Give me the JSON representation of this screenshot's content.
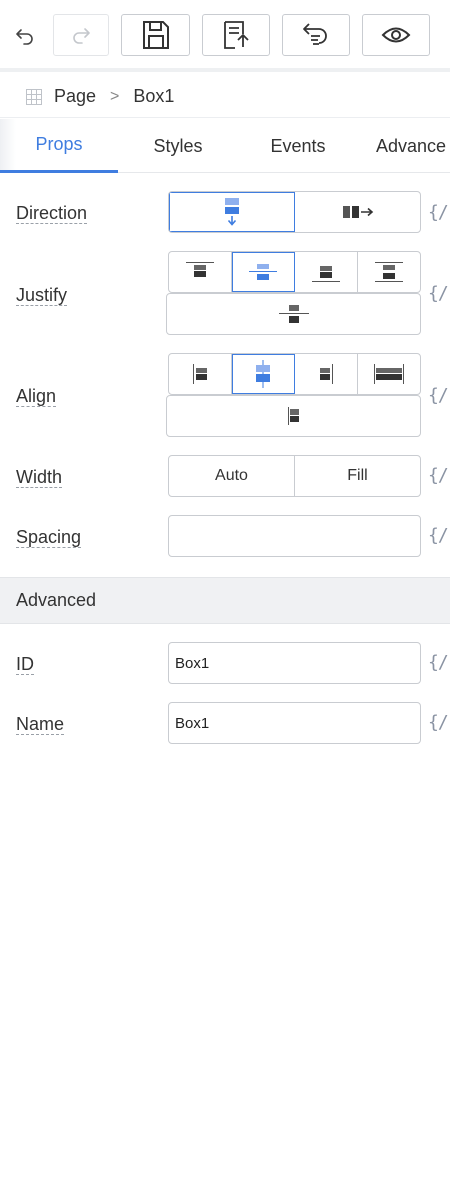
{
  "toolbar": {
    "undo_icon": "undo-icon",
    "redo_icon": "redo-icon",
    "save_icon": "save-icon",
    "export_icon": "export-icon",
    "revert_icon": "revert-icon",
    "preview_icon": "eye-icon"
  },
  "breadcrumb": {
    "root": "Page",
    "separator": ">",
    "current": "Box1"
  },
  "tabs": [
    {
      "label": "Props",
      "active": true
    },
    {
      "label": "Styles",
      "active": false
    },
    {
      "label": "Events",
      "active": false
    },
    {
      "label": "Advance",
      "active": false
    }
  ],
  "props": {
    "direction": {
      "label": "Direction",
      "options": [
        "vertical",
        "horizontal"
      ],
      "selected": "vertical"
    },
    "justify": {
      "label": "Justify",
      "options": [
        "start",
        "center",
        "end",
        "space-between",
        "space-around"
      ],
      "selected": "center"
    },
    "align": {
      "label": "Align",
      "options": [
        "start",
        "center",
        "end",
        "stretch",
        "baseline"
      ],
      "selected": "center"
    },
    "width": {
      "label": "Width",
      "options": [
        "Auto",
        "Fill"
      ]
    },
    "spacing": {
      "label": "Spacing",
      "value": ""
    },
    "binding_symbol": "{/"
  },
  "advanced": {
    "header": "Advanced",
    "id": {
      "label": "ID",
      "value": "Box1"
    },
    "name": {
      "label": "Name",
      "value": "Box1"
    }
  },
  "colors": {
    "accent": "#3f7de0",
    "accent_light": "#8fb0ee",
    "icon_dark": "#333333",
    "border": "#c9ccd1"
  }
}
